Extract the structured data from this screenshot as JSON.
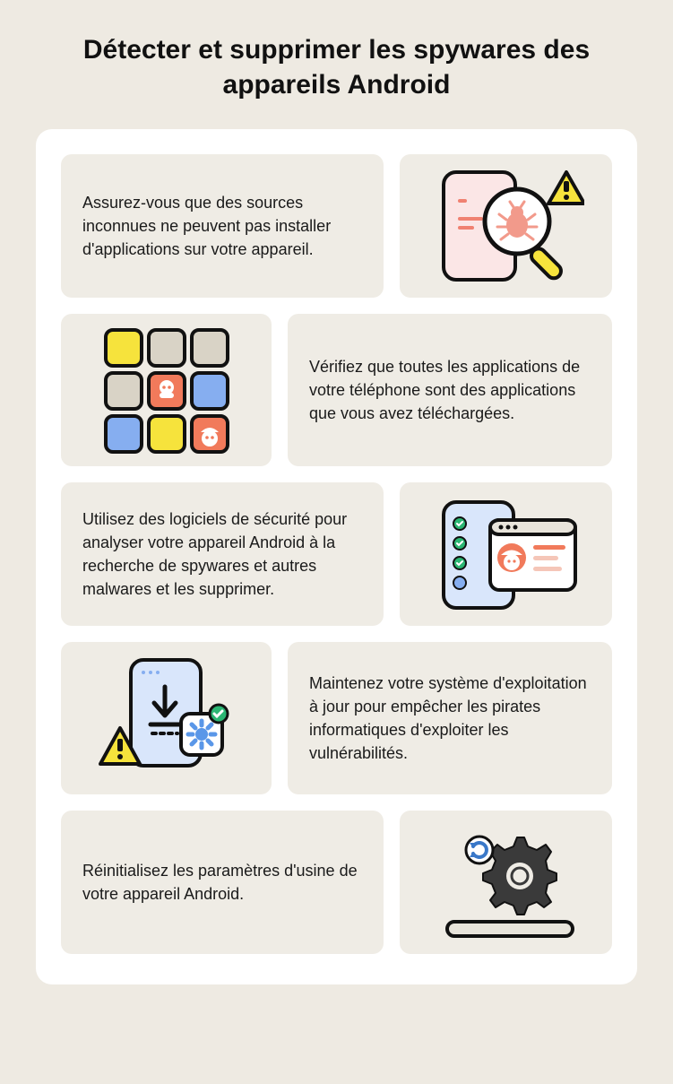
{
  "title": "Détecter et supprimer les spywares des appareils Android",
  "items": [
    {
      "text": "Assurez-vous que des sources inconnues ne peuvent pas installer d'applications sur votre appareil."
    },
    {
      "text": "Vérifiez que toutes les applications de votre téléphone sont des applications que vous avez téléchargées."
    },
    {
      "text": "Utilisez des logiciels de sécurité pour analyser votre appareil Android à la recherche de spywares et autres malwares et les supprimer."
    },
    {
      "text": "Maintenez votre système d'exploitation à jour pour empêcher les pirates informatiques d'exploiter les vulnérabilités."
    },
    {
      "text": "Réinitialisez les paramètres d'usine de votre appareil Android."
    }
  ]
}
